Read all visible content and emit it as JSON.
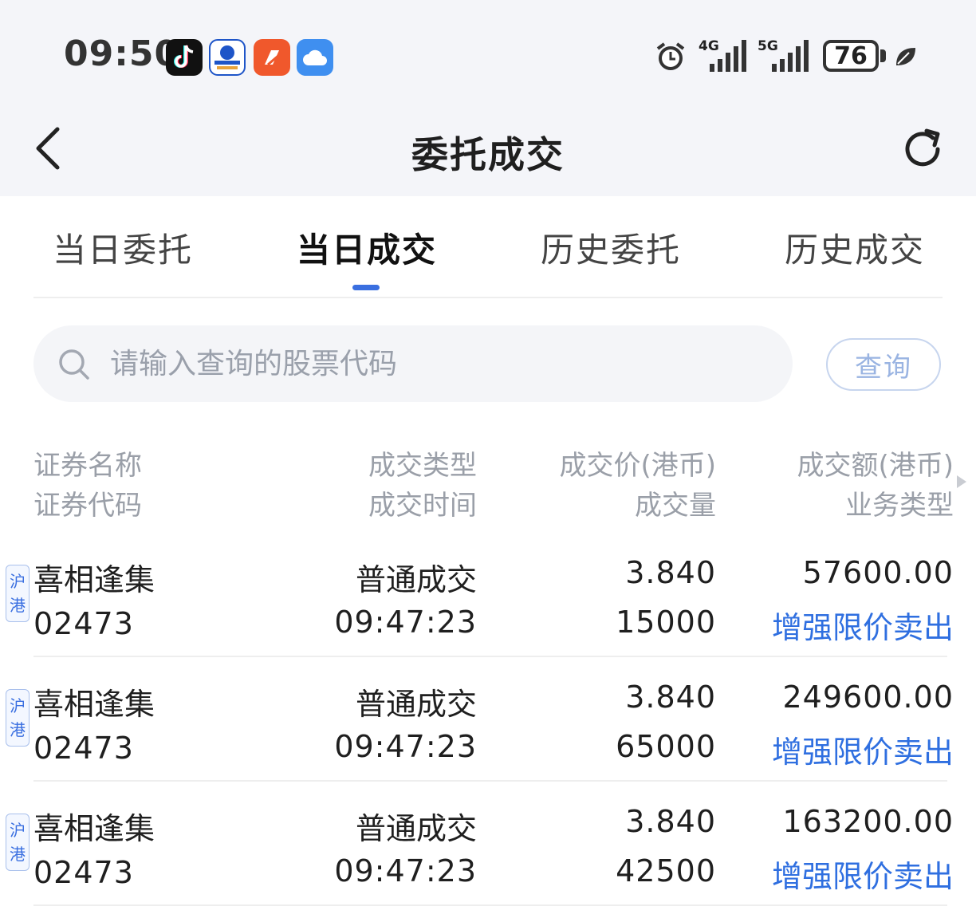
{
  "status_bar": {
    "time": "09:50",
    "apps": [
      {
        "icon": "tiktok-icon",
        "color": "#111111"
      },
      {
        "icon": "broker-app-icon",
        "color": "#1e55c8"
      },
      {
        "icon": "news-app-icon",
        "color": "#f0582c"
      },
      {
        "icon": "cloud-app-icon",
        "color": "#3f8ff0"
      }
    ],
    "signal_1": "4G",
    "signal_2": "5G",
    "battery": "76"
  },
  "nav": {
    "title": "委托成交"
  },
  "tabs": [
    {
      "label": "当日委托",
      "active": false
    },
    {
      "label": "当日成交",
      "active": true
    },
    {
      "label": "历史委托",
      "active": false
    },
    {
      "label": "历史成交",
      "active": false
    }
  ],
  "search": {
    "placeholder": "请输入查询的股票代码",
    "button_label": "查询"
  },
  "table": {
    "headers": {
      "col1_line1": "证券名称",
      "col1_line2": "证券代码",
      "col2_line1": "成交类型",
      "col2_line2": "成交时间",
      "col3_line1": "成交价(港币)",
      "col3_line2": "成交量",
      "col4_line1": "成交额(港币)",
      "col4_line2": "业务类型"
    },
    "rows": [
      {
        "market_tag_1": "沪",
        "market_tag_2": "港",
        "name": "喜相逢集",
        "code": "02473",
        "type": "普通成交",
        "time": "09:47:23",
        "price": "3.840",
        "volume": "15000",
        "amount": "57600.00",
        "business": "增强限价卖出"
      },
      {
        "market_tag_1": "沪",
        "market_tag_2": "港",
        "name": "喜相逢集",
        "code": "02473",
        "type": "普通成交",
        "time": "09:47:23",
        "price": "3.840",
        "volume": "65000",
        "amount": "249600.00",
        "business": "增强限价卖出"
      },
      {
        "market_tag_1": "沪",
        "market_tag_2": "港",
        "name": "喜相逢集",
        "code": "02473",
        "type": "普通成交",
        "time": "09:47:23",
        "price": "3.840",
        "volume": "42500",
        "amount": "163200.00",
        "business": "增强限价卖出"
      }
    ]
  },
  "colors": {
    "accent": "#3a6fe0",
    "business_text": "#2f6fe0",
    "muted_text": "#9a9fa8"
  }
}
